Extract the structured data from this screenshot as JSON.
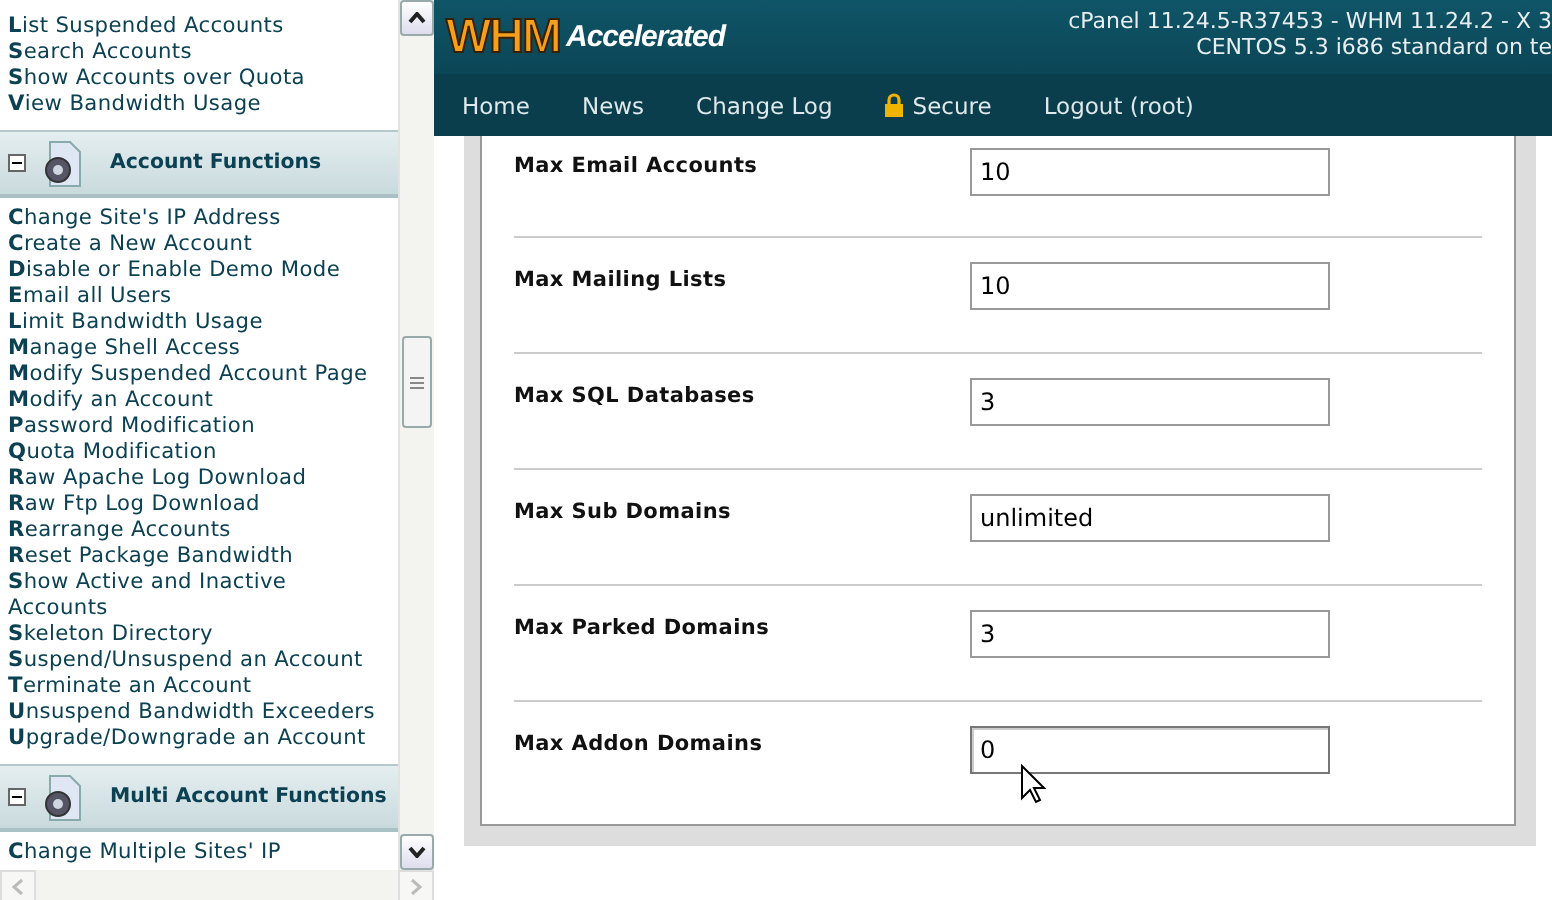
{
  "sidebar": {
    "sections": [
      {
        "kind": "links",
        "items": [
          "**L**ist Suspended Accounts",
          "**S**earch Accounts",
          "**S**how Accounts over Quota",
          "**V**iew Bandwidth Usage"
        ]
      },
      {
        "kind": "header",
        "title": "Account Functions",
        "expanded": true
      },
      {
        "kind": "links",
        "items": [
          "**C**hange Site's IP Address",
          "**C**reate a New Account",
          "**D**isable or Enable Demo Mode",
          "**E**mail all Users",
          "**L**imit Bandwidth Usage",
          "**M**anage Shell Access",
          "**M**odify Suspended Account Page",
          "**M**odify an Account",
          "**P**assword Modification",
          "**Q**uota Modification",
          "**R**aw Apache Log Download",
          "**R**aw Ftp Log Download",
          "**R**earrange Accounts",
          "**R**eset Package Bandwidth",
          "**S**how Active and Inactive Accounts",
          "**S**keleton Directory",
          "**S**uspend/Unsuspend an Account",
          "**T**erminate an Account",
          "**U**nsuspend Bandwidth Exceeders",
          "**U**pgrade/Downgrade an Account"
        ]
      },
      {
        "kind": "header",
        "title": "Multi Account Functions",
        "expanded": true
      },
      {
        "kind": "links",
        "items": [
          "**C**hange Multiple Sites' IP"
        ]
      }
    ]
  },
  "header": {
    "logo_main": "WHM",
    "logo_sub": "Accelerated",
    "version_line_1": "cPanel 11.24.5-R37453 - WHM 11.24.2 - X 3",
    "version_line_2": "CENTOS 5.3 i686 standard on te"
  },
  "nav": [
    {
      "label": "Home",
      "kind": "plain"
    },
    {
      "label": "News",
      "kind": "plain"
    },
    {
      "label": "Change Log",
      "kind": "plain"
    },
    {
      "label": "Secure",
      "kind": "lock"
    },
    {
      "label": "Logout (root)",
      "kind": "plain"
    }
  ],
  "form": {
    "rows": [
      {
        "label": "Max Email Accounts",
        "value": "10"
      },
      {
        "label": "Max Mailing Lists",
        "value": "10"
      },
      {
        "label": "Max SQL Databases",
        "value": "3"
      },
      {
        "label": "Max Sub Domains",
        "value": "unlimited"
      },
      {
        "label": "Max Parked Domains",
        "value": "3"
      },
      {
        "label": "Max Addon Domains",
        "value": "0",
        "focused": true
      }
    ]
  }
}
